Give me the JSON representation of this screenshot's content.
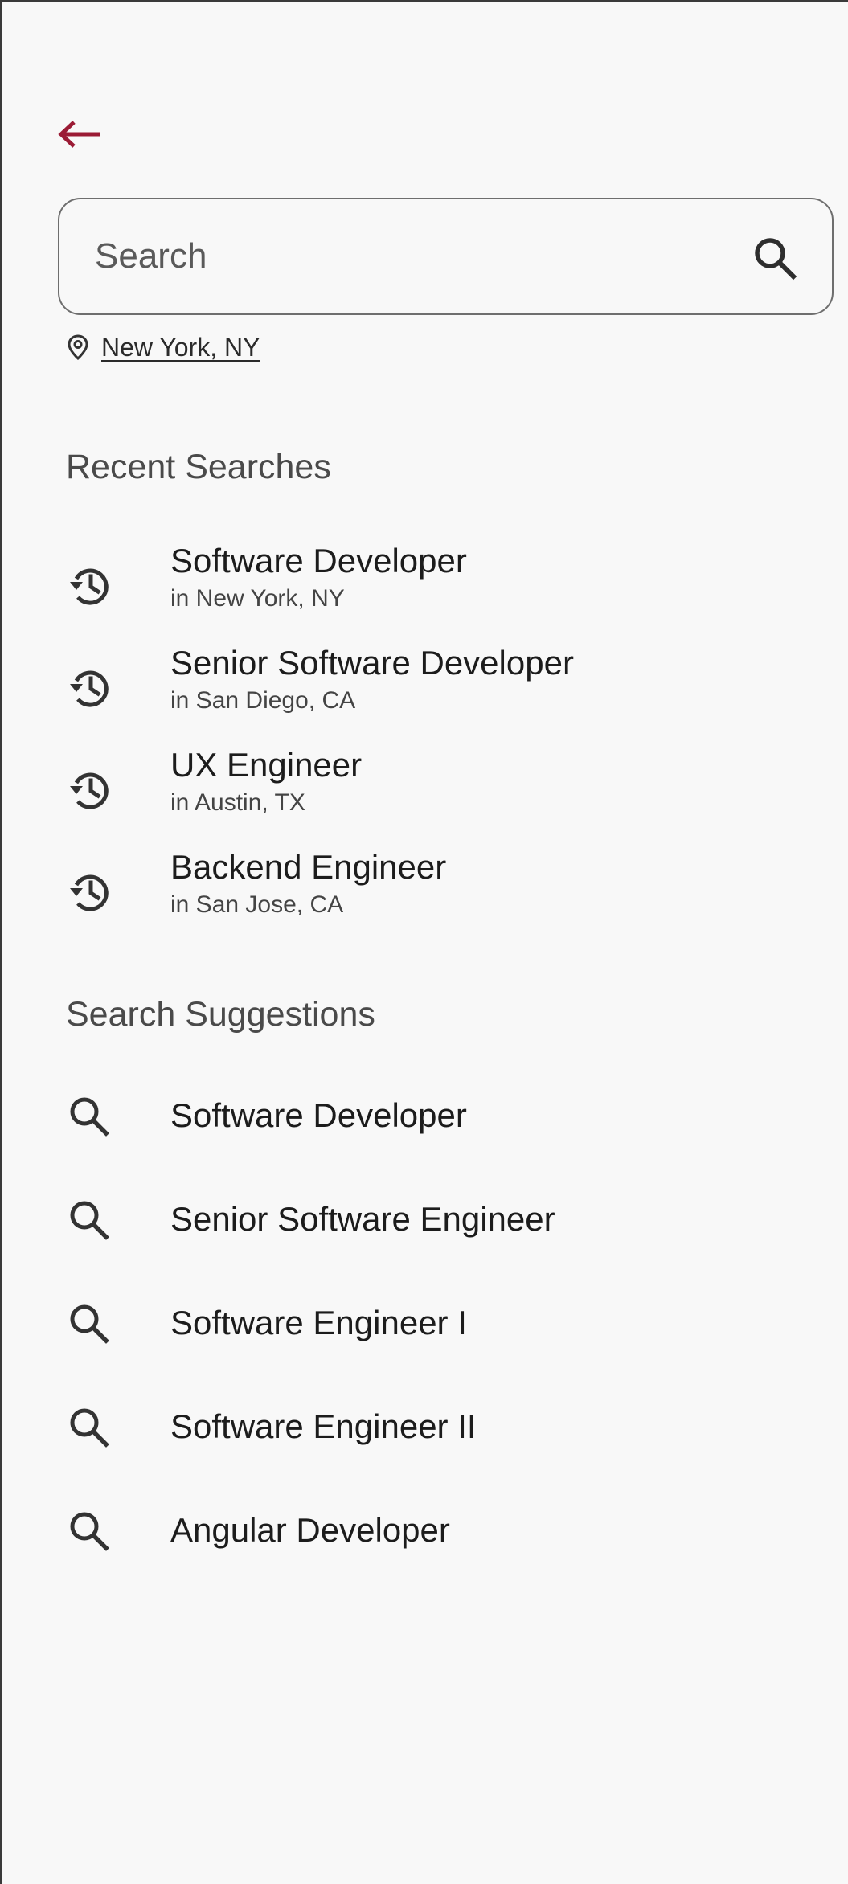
{
  "colors": {
    "accent": "#9b1b35",
    "text_primary": "#1c1c1c",
    "text_secondary": "#4a4a4a",
    "background": "#f8f8f8",
    "border": "#6e6e6e"
  },
  "header": {
    "back_icon": "arrow-left-icon"
  },
  "search": {
    "placeholder": "Search",
    "value": "",
    "icon": "search-icon"
  },
  "location": {
    "icon": "map-pin-icon",
    "label": "New York, NY"
  },
  "recent": {
    "title": "Recent Searches",
    "icon": "history-icon",
    "items": [
      {
        "title": "Software Developer",
        "location": "in New York, NY"
      },
      {
        "title": "Senior Software Developer",
        "location": "in San Diego, CA"
      },
      {
        "title": "UX Engineer",
        "location": "in Austin, TX"
      },
      {
        "title": "Backend Engineer",
        "location": "in San Jose, CA"
      }
    ]
  },
  "suggestions": {
    "title": "Search Suggestions",
    "icon": "search-icon",
    "items": [
      {
        "label": "Software Developer"
      },
      {
        "label": "Senior Software Engineer"
      },
      {
        "label": "Software Engineer I"
      },
      {
        "label": "Software Engineer II"
      },
      {
        "label": "Angular Developer"
      }
    ]
  }
}
